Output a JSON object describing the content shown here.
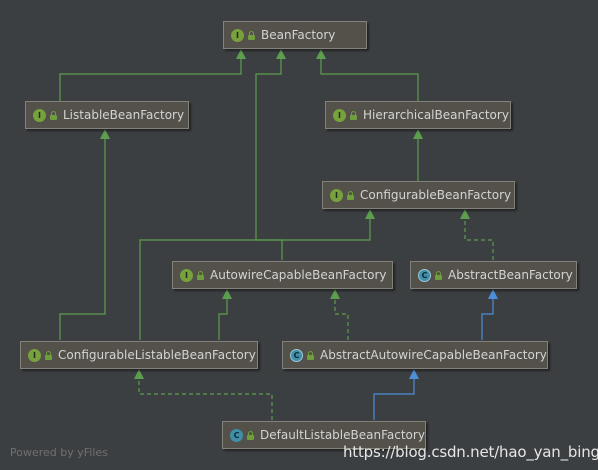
{
  "colors": {
    "background": "#3c3f41",
    "node_fill": "#53514a",
    "node_border": "#83827a",
    "node_text": "#d4d4d4",
    "extends_edge": "#5c9e4d",
    "class_extends_edge": "#4d8ed9",
    "interface_badge": "#77a13d",
    "class_badge": "#3f8fa8"
  },
  "nodes": {
    "bean_factory": {
      "label": "BeanFactory",
      "kind": "interface",
      "badge": "I"
    },
    "listable_bean_factory": {
      "label": "ListableBeanFactory",
      "kind": "interface",
      "badge": "I"
    },
    "hierarchical_bean_factory": {
      "label": "HierarchicalBeanFactory",
      "kind": "interface",
      "badge": "I"
    },
    "configurable_bean_factory": {
      "label": "ConfigurableBeanFactory",
      "kind": "interface",
      "badge": "I"
    },
    "autowire_capable_bean_factory": {
      "label": "AutowireCapableBeanFactory",
      "kind": "interface",
      "badge": "I"
    },
    "abstract_bean_factory": {
      "label": "AbstractBeanFactory",
      "kind": "abstract-class",
      "badge": "C"
    },
    "configurable_listable_bean_factory": {
      "label": "ConfigurableListableBeanFactory",
      "kind": "interface",
      "badge": "I"
    },
    "abstract_autowire_capable_bean_factory": {
      "label": "AbstractAutowireCapableBeanFactory",
      "kind": "abstract-class",
      "badge": "C"
    },
    "default_listable_bean_factory": {
      "label": "DefaultListableBeanFactory",
      "kind": "class",
      "badge": "C"
    }
  },
  "edges": [
    {
      "from": "Listable­BeanFactory",
      "to": "BeanFactory",
      "type": "extends"
    },
    {
      "from": "HierarchicalBeanFactory",
      "to": "BeanFactory",
      "type": "extends"
    },
    {
      "from": "AutowireCapableBeanFactory",
      "to": "BeanFactory",
      "type": "extends"
    },
    {
      "from": "ConfigurableBeanFactory",
      "to": "HierarchicalBeanFactory",
      "type": "extends"
    },
    {
      "from": "AbstractBeanFactory",
      "to": "ConfigurableBeanFactory",
      "type": "implements"
    },
    {
      "from": "ConfigurableListableBeanFactory",
      "to": "ListableBeanFactory",
      "type": "extends"
    },
    {
      "from": "ConfigurableListableBeanFactory",
      "to": "ConfigurableBeanFactory",
      "type": "extends"
    },
    {
      "from": "ConfigurableListableBeanFactory",
      "to": "AutowireCapableBeanFactory",
      "type": "extends"
    },
    {
      "from": "AbstractAutowireCapableBeanFactory",
      "to": "AbstractBeanFactory",
      "type": "class-extends"
    },
    {
      "from": "AbstractAutowireCapableBeanFactory",
      "to": "AutowireCapableBeanFactory",
      "type": "implements"
    },
    {
      "from": "DefaultListableBeanFactory",
      "to": "AbstractAutowireCapableBeanFactory",
      "type": "class-extends"
    },
    {
      "from": "DefaultListableBeanFactory",
      "to": "ConfigurableListableBeanFactory",
      "type": "implements"
    }
  ],
  "footer": {
    "text": "Powered by yFiles"
  },
  "watermark": {
    "text": "https://blog.csdn.net/hao_yan_bing"
  }
}
